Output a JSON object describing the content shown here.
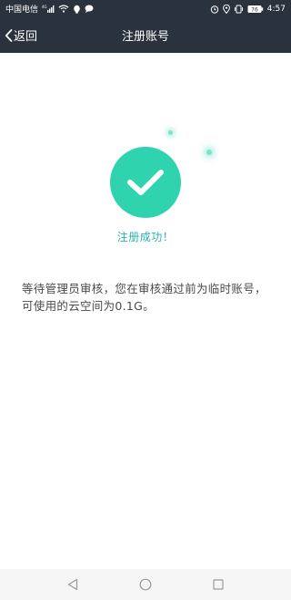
{
  "status_bar": {
    "carrier": "中国电信",
    "signal_text": "4G",
    "battery_percent": "76",
    "time": "4:57"
  },
  "nav": {
    "back_label": "返回",
    "title": "注册账号"
  },
  "content": {
    "success_text": "注册成功！",
    "description": "等待管理员审核，您在审核通过前为临时账号，可使用的云空间为0.1G。"
  },
  "colors": {
    "header_bg": "#2a323d",
    "success_green": "#2fd3ad",
    "success_text": "#2ab2b0"
  },
  "icons": {
    "status_left": [
      "signal-icon",
      "wifi-icon",
      "notification-icon",
      "chat-icon"
    ],
    "status_right": [
      "alarm-icon",
      "location-icon",
      "vibrate-icon",
      "battery-icon"
    ],
    "bottom_nav": [
      "back-triangle-icon",
      "home-circle-icon",
      "recents-square-icon"
    ]
  }
}
